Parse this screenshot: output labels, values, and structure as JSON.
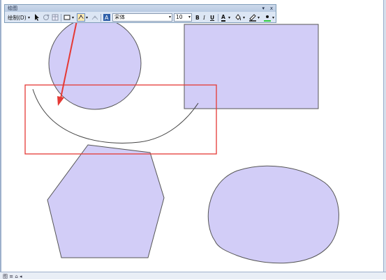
{
  "toolbar": {
    "title": "绘图",
    "pin": "▾",
    "close": "x",
    "draw_menu": "绘制(D)",
    "font_name": "宋体",
    "font_size": "10",
    "bold": "B",
    "italic": "I",
    "underline": "U",
    "font_color_label": "A"
  },
  "status": {
    "mini_label": "图 ≡ ⌂ ◂"
  },
  "colors": {
    "shape_fill": "#d2cdf7",
    "shape_stroke": "#555555",
    "highlight": "#e53935",
    "arrow": "#e53935",
    "toolbar_bg": "#dce6f4"
  },
  "icons": [
    "pointer-icon",
    "rotate-icon",
    "table-icon",
    "rectangle-icon",
    "edit-vertices-icon",
    "reshape-icon",
    "text-icon",
    "font-color-icon",
    "fill-color-icon",
    "line-color-icon",
    "marker-color-icon"
  ]
}
